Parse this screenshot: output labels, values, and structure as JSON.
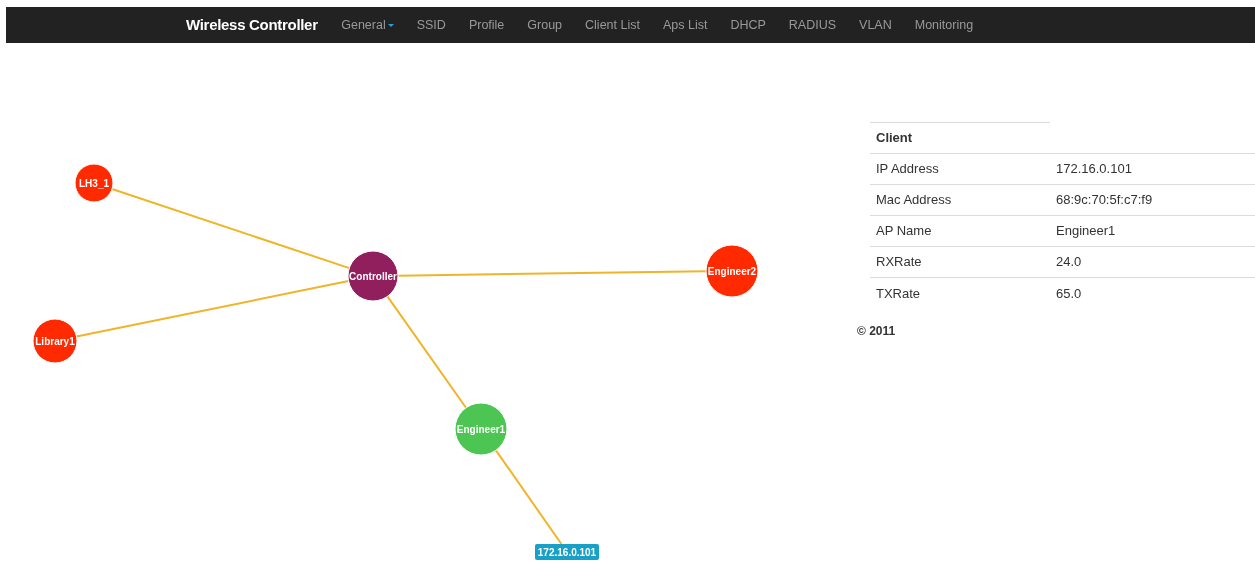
{
  "navbar": {
    "brand": "Wireless Controller",
    "items": [
      {
        "label": "General",
        "dropdown": true
      },
      {
        "label": "SSID",
        "dropdown": false
      },
      {
        "label": "Profile",
        "dropdown": false
      },
      {
        "label": "Group",
        "dropdown": false
      },
      {
        "label": "Client List",
        "dropdown": false
      },
      {
        "label": "Aps List",
        "dropdown": false
      },
      {
        "label": "DHCP",
        "dropdown": false
      },
      {
        "label": "RADIUS",
        "dropdown": false
      },
      {
        "label": "VLAN",
        "dropdown": false
      },
      {
        "label": "Monitoring",
        "dropdown": false
      }
    ]
  },
  "graph": {
    "nodes": [
      {
        "label": "LH3_1",
        "kind": "ap",
        "color": "#ff2a00"
      },
      {
        "label": "Library1",
        "kind": "ap",
        "color": "#ff2a00"
      },
      {
        "label": "Controller",
        "kind": "controller",
        "color": "#911f5e"
      },
      {
        "label": "Engineer2",
        "kind": "ap",
        "color": "#ff2a00"
      },
      {
        "label": "Engineer1",
        "kind": "ap",
        "color": "#4cc552"
      },
      {
        "label": "172.16.0.101",
        "kind": "client",
        "color": "#19a0c6"
      }
    ]
  },
  "client_table": {
    "heading": "Client",
    "rows": [
      {
        "label": "IP Address",
        "value": "172.16.0.101"
      },
      {
        "label": "Mac Address",
        "value": "68:9c:70:5f:c7:f9"
      },
      {
        "label": "AP Name",
        "value": "Engineer1"
      },
      {
        "label": "RXRate",
        "value": "24.0"
      },
      {
        "label": "TXRate",
        "value": "65.0"
      }
    ]
  },
  "footer": "© 2011"
}
